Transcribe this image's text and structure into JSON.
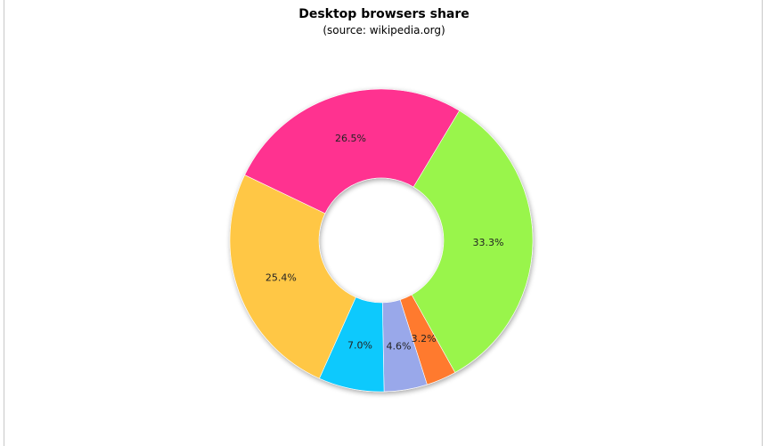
{
  "chart_data": {
    "type": "pie",
    "style": "donut",
    "title": "Desktop browsers share",
    "subtitle": "(source: wikipedia.org)",
    "series": [
      {
        "label": "33.3%",
        "value": 33.3,
        "color": "#99f54b"
      },
      {
        "label": "3.2%",
        "value": 3.2,
        "color": "#ff7a2f"
      },
      {
        "label": "4.6%",
        "value": 4.6,
        "color": "#99a8ea"
      },
      {
        "label": "7.0%",
        "value": 7.0,
        "color": "#11c9fd"
      },
      {
        "label": "25.4%",
        "value": 25.4,
        "color": "#ffc745"
      },
      {
        "label": "26.5%",
        "value": 26.5,
        "color": "#ff3090"
      }
    ],
    "legend": "none"
  }
}
